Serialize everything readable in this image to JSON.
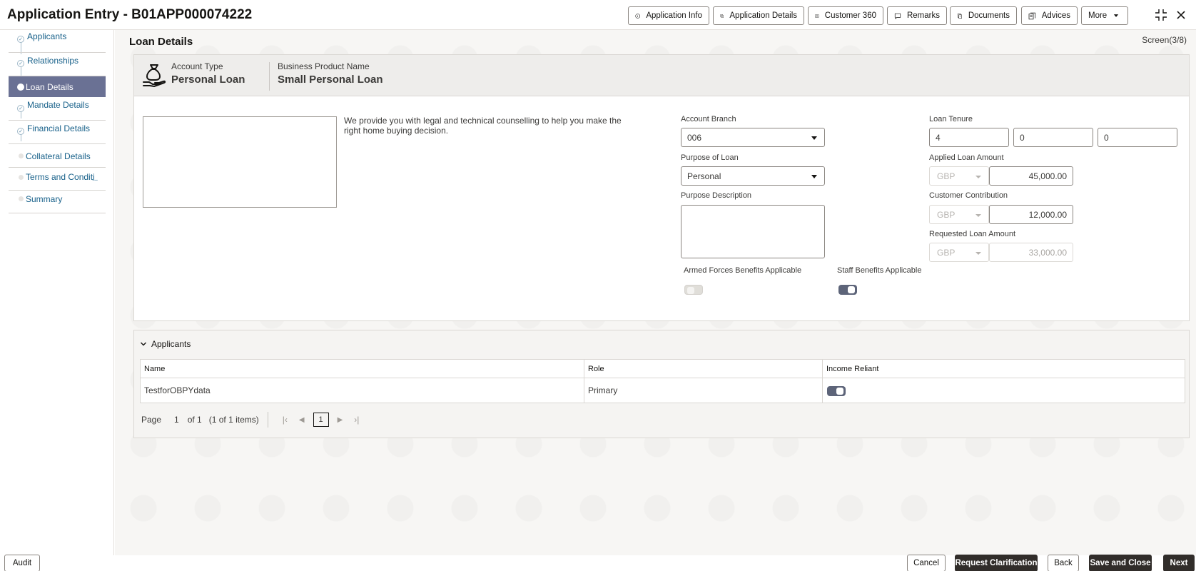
{
  "header": {
    "title": "Application Entry - B01APP000074222",
    "buttons": {
      "app_info": "Application Info",
      "app_details": "Application Details",
      "customer360": "Customer 360",
      "remarks": "Remarks",
      "documents": "Documents",
      "advices": "Advices",
      "more": "More"
    }
  },
  "sidebar": {
    "steps": [
      {
        "label": "Applicants",
        "state": "done"
      },
      {
        "label": "Relationships",
        "state": "done"
      },
      {
        "label": "Loan Details",
        "state": "active"
      },
      {
        "label": "Mandate Details",
        "state": "done"
      },
      {
        "label": "Financial Details",
        "state": "done"
      },
      {
        "label": "Collateral Details",
        "state": "todo"
      },
      {
        "label": "Terms and Conditi",
        "state": "todo",
        "more": "..."
      },
      {
        "label": "Summary",
        "state": "todo"
      }
    ]
  },
  "page": {
    "title": "Loan Details",
    "screen": "Screen(3/8)"
  },
  "account": {
    "type_label": "Account Type",
    "type_value": "Personal Loan",
    "product_label": "Business Product Name",
    "product_value": "Small Personal Loan",
    "description": "We provide you with legal and technical counselling to help you make the right home buying decision."
  },
  "form": {
    "account_branch": {
      "label": "Account Branch",
      "value": "006"
    },
    "purpose": {
      "label": "Purpose of Loan",
      "value": "Personal"
    },
    "purpose_desc": {
      "label": "Purpose Description",
      "value": ""
    },
    "armed_forces": {
      "label": "Armed Forces Benefits Applicable",
      "on": false
    },
    "staff_benefits": {
      "label": "Staff Benefits Applicable",
      "on": true
    },
    "tenure": {
      "label": "Loan Tenure",
      "years": "4",
      "months": "0",
      "days": "0"
    },
    "applied_amount": {
      "label": "Applied Loan Amount",
      "currency": "GBP",
      "value": "45,000.00"
    },
    "customer_contribution": {
      "label": "Customer Contribution",
      "currency": "GBP",
      "value": "12,000.00"
    },
    "requested_amount": {
      "label": "Requested Loan Amount",
      "currency": "GBP",
      "value": "33,000.00"
    }
  },
  "applicants": {
    "title": "Applicants",
    "columns": [
      "Name",
      "Role",
      "Income Reliant"
    ],
    "rows": [
      {
        "name": "TestforOBPYdata",
        "role": "Primary",
        "income_reliant": true
      }
    ],
    "pager": {
      "page_label": "Page",
      "page": "1",
      "of": "of 1",
      "items": "(1 of 1 items)",
      "current": "1"
    }
  },
  "footer": {
    "audit": "Audit",
    "cancel": "Cancel",
    "request_clarification": "Request Clarification",
    "back": "Back",
    "save_close": "Save and Close",
    "next": "Next"
  },
  "colors": {
    "active_step": "#6a7194",
    "toggle_on": "#5d6479",
    "primary_button": "#312d2a"
  }
}
